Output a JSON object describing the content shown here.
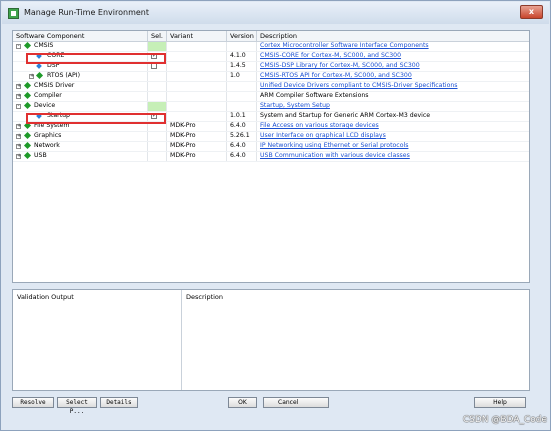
{
  "window": {
    "title": "Manage Run-Time Environment",
    "close_glyph": "x"
  },
  "table": {
    "headers": {
      "component": "Software Component",
      "sel": "Sel.",
      "variant": "Variant",
      "version": "Version",
      "description": "Description"
    },
    "rows": [
      {
        "name": "CMSIS",
        "level": 0,
        "expander": "-",
        "icon": "green-diamond-icon",
        "checkbox": null,
        "variant": "",
        "version": "",
        "description": "Cortex Microcontroller Software Interface Components",
        "link": true,
        "sel_green": true
      },
      {
        "name": "CORE",
        "level": 1,
        "expander": null,
        "icon": "blue-gem-icon",
        "checkbox": "checked",
        "variant": "",
        "version": "4.1.0",
        "description": "CMSIS-CORE for Cortex-M, SC000, and SC300",
        "link": true,
        "sel_green": false
      },
      {
        "name": "DSP",
        "level": 1,
        "expander": null,
        "icon": "blue-gem-icon",
        "checkbox": "unchecked",
        "variant": "",
        "version": "1.4.5",
        "description": "CMSIS-DSP Library for Cortex-M, SC000, and SC300",
        "link": true,
        "sel_green": false
      },
      {
        "name": "RTOS (API)",
        "level": 1,
        "expander": "+",
        "icon": "green-diamond-icon",
        "checkbox": null,
        "variant": "",
        "version": "1.0",
        "description": "CMSIS-RTOS API for Cortex-M, SC000, and SC300",
        "link": true,
        "sel_green": false
      },
      {
        "name": "CMSIS Driver",
        "level": 0,
        "expander": "+",
        "icon": "green-diamond-icon",
        "checkbox": null,
        "variant": "",
        "version": "",
        "description": "Unified Device Drivers compliant to CMSIS-Driver Specifications",
        "link": true,
        "sel_green": false
      },
      {
        "name": "Compiler",
        "level": 0,
        "expander": "+",
        "icon": "green-diamond-icon",
        "checkbox": null,
        "variant": "",
        "version": "",
        "description": "ARM Compiler Software Extensions",
        "link": false,
        "sel_green": false
      },
      {
        "name": "Device",
        "level": 0,
        "expander": "-",
        "icon": "green-diamond-icon",
        "checkbox": null,
        "variant": "",
        "version": "",
        "description": "Startup, System Setup",
        "link": true,
        "sel_green": true
      },
      {
        "name": "Startup",
        "level": 1,
        "expander": null,
        "icon": "blue-gem-icon",
        "checkbox": "checked",
        "variant": "",
        "version": "1.0.1",
        "description": "System and Startup for Generic ARM Cortex-M3 device",
        "link": false,
        "sel_green": false
      },
      {
        "name": "File System",
        "level": 0,
        "expander": "+",
        "icon": "green-diamond-icon",
        "checkbox": null,
        "variant": "MDK-Pro",
        "version": "6.4.0",
        "description": "File Access on various storage devices",
        "link": true,
        "sel_green": false
      },
      {
        "name": "Graphics",
        "level": 0,
        "expander": "+",
        "icon": "green-diamond-icon",
        "checkbox": null,
        "variant": "MDK-Pro",
        "version": "5.26.1",
        "description": "User Interface on graphical LCD displays",
        "link": true,
        "sel_green": false
      },
      {
        "name": "Network",
        "level": 0,
        "expander": "+",
        "icon": "green-diamond-icon",
        "checkbox": null,
        "variant": "MDK-Pro",
        "version": "6.4.0",
        "description": "IP Networking using Ethernet or Serial protocols",
        "link": true,
        "sel_green": false
      },
      {
        "name": "USB",
        "level": 0,
        "expander": "+",
        "icon": "green-diamond-icon",
        "checkbox": null,
        "variant": "MDK-Pro",
        "version": "6.4.0",
        "description": "USB Communication with various device classes",
        "link": true,
        "sel_green": false
      }
    ]
  },
  "validation": {
    "output_header": "Validation Output",
    "description_header": "Description"
  },
  "buttons": {
    "resolve": "Resolve",
    "select": "Select P...",
    "details": "Details",
    "ok": "OK",
    "cancel": "Cancel",
    "help": "Help"
  },
  "watermark": "CSDN @BDA_Code",
  "colors": {
    "highlight": "#e03030",
    "sel_green": "#c6efb7",
    "link": "#1a4fd1"
  }
}
